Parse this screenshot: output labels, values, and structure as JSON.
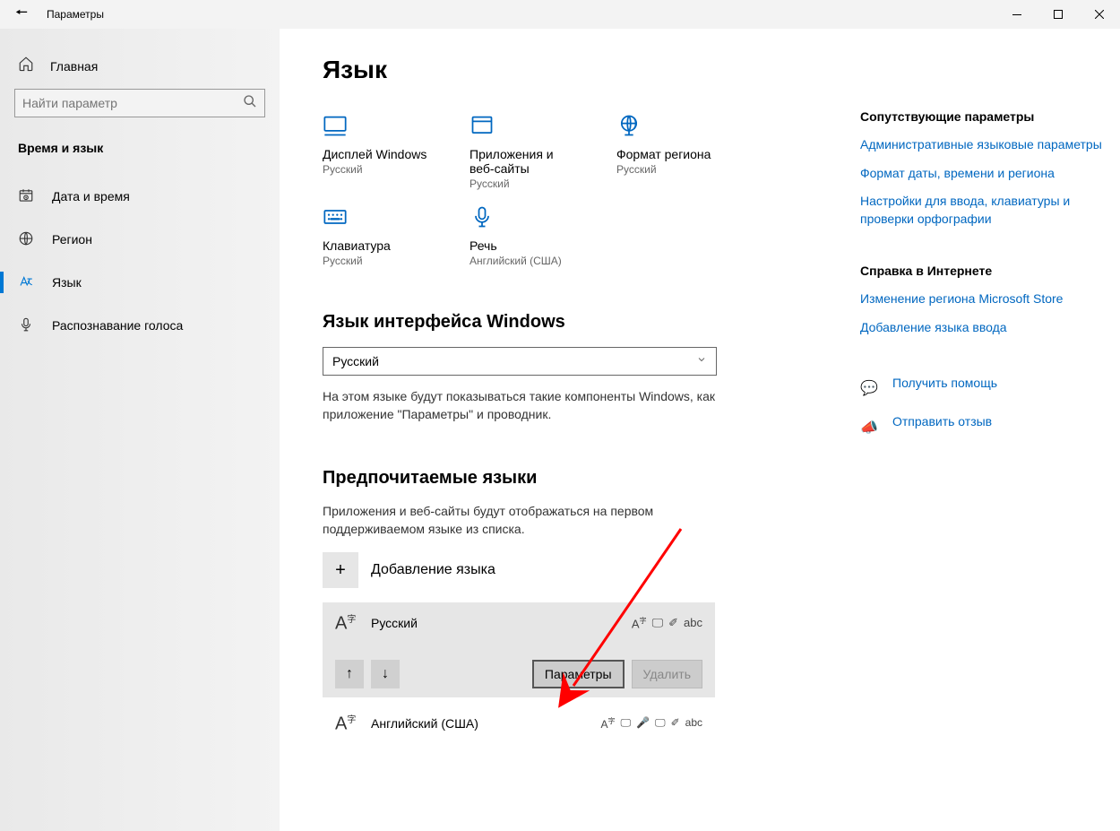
{
  "titlebar": {
    "title": "Параметры"
  },
  "sidebar": {
    "home": "Главная",
    "search_placeholder": "Найти параметр",
    "category": "Время и язык",
    "items": [
      {
        "label": "Дата и время"
      },
      {
        "label": "Регион"
      },
      {
        "label": "Язык"
      },
      {
        "label": "Распознавание голоса"
      }
    ]
  },
  "page": {
    "heading": "Язык",
    "tiles": [
      {
        "title": "Дисплей Windows",
        "sub": "Русский"
      },
      {
        "title": "Приложения и веб-сайты",
        "sub": "Русский"
      },
      {
        "title": "Формат региона",
        "sub": "Русский"
      },
      {
        "title": "Клавиатура",
        "sub": "Русский"
      },
      {
        "title": "Речь",
        "sub": "Английский (США)"
      }
    ],
    "display_section": {
      "heading": "Язык интерфейса Windows",
      "selected": "Русский",
      "desc": "На этом языке будут показываться такие компоненты Windows, как приложение \"Параметры\" и проводник."
    },
    "preferred": {
      "heading": "Предпочитаемые языки",
      "desc": "Приложения и веб-сайты будут отображаться на первом поддерживаемом языке из списка.",
      "add": "Добавление языка",
      "langs": [
        {
          "name": "Русский"
        },
        {
          "name": "Английский (США)"
        }
      ],
      "btn_options": "Параметры",
      "btn_remove": "Удалить"
    }
  },
  "rail": {
    "related_heading": "Сопутствующие параметры",
    "related_links": [
      "Административные языковые параметры",
      "Формат даты, времени и региона",
      "Настройки для ввода, клавиатуры и проверки орфографии"
    ],
    "help_heading": "Справка в Интернете",
    "help_links": [
      "Изменение региона Microsoft Store",
      "Добавление языка ввода"
    ],
    "support_help": "Получить помощь",
    "support_feedback": "Отправить отзыв"
  }
}
